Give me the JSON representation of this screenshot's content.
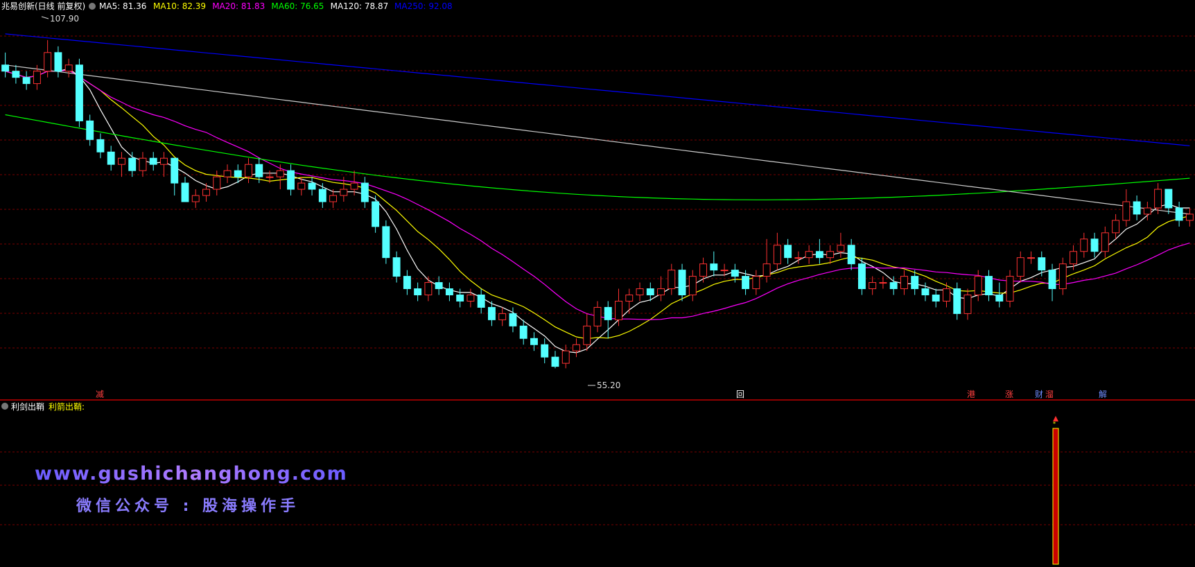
{
  "header": {
    "title": "兆易创新(日线 前复权)",
    "ma_items": [
      {
        "label": "MA5: 81.36",
        "color": "#ffffff"
      },
      {
        "label": "MA10: 82.39",
        "color": "#ffff00"
      },
      {
        "label": "MA20: 81.83",
        "color": "#ff00ff"
      },
      {
        "label": "MA60: 76.65",
        "color": "#00ff00"
      },
      {
        "label": "MA120: 78.87",
        "color": "#ffffff"
      },
      {
        "label": "MA250: 92.08",
        "color": "#0000ff"
      }
    ]
  },
  "indicator": {
    "name": "利剑出鞘",
    "value_label": "利箭出鞘:"
  },
  "watermark": {
    "url": "www.gushichanghong.com",
    "wechat": "微信公众号 : 股海操作手"
  },
  "colors": {
    "up": "#ff3232",
    "down": "#54ffff",
    "grid": "#7a0000",
    "ma5": "#ffffff",
    "ma10": "#ffff00",
    "ma20": "#ff00ff",
    "ma60": "#00ff00",
    "ma120": "#cccccc",
    "ma250": "#0000ff"
  },
  "chart_data": {
    "type": "candlestick",
    "y_range": [
      52,
      112
    ],
    "high_label": "107.90",
    "low_label": "55.20",
    "candles": [
      [
        104,
        103,
        106,
        102
      ],
      [
        103,
        102,
        104,
        101
      ],
      [
        102,
        101,
        103,
        100
      ],
      [
        101,
        103,
        104,
        100
      ],
      [
        103,
        106,
        108,
        102
      ],
      [
        106,
        103,
        107,
        102
      ],
      [
        103,
        104,
        105,
        102
      ],
      [
        104,
        95,
        105,
        94
      ],
      [
        95,
        92,
        96,
        91
      ],
      [
        92,
        90,
        93,
        89
      ],
      [
        90,
        88,
        91,
        87
      ],
      [
        88,
        89,
        90,
        86
      ],
      [
        89,
        87,
        90,
        86
      ],
      [
        87,
        89,
        90,
        86
      ],
      [
        89,
        88,
        90,
        87
      ],
      [
        88,
        89,
        90,
        86
      ],
      [
        89,
        85,
        89,
        83
      ],
      [
        85,
        82,
        86,
        82
      ],
      [
        82,
        83,
        84,
        81
      ],
      [
        83,
        84,
        85,
        82
      ],
      [
        84,
        86,
        87,
        83
      ],
      [
        86,
        87,
        88,
        85
      ],
      [
        87,
        86,
        88,
        85
      ],
      [
        86,
        88,
        89,
        85
      ],
      [
        88,
        86,
        89,
        85
      ],
      [
        86,
        86,
        87,
        85
      ],
      [
        86,
        87,
        88,
        84
      ],
      [
        87,
        84,
        88,
        83
      ],
      [
        84,
        85,
        86,
        83
      ],
      [
        85,
        84,
        86,
        83
      ],
      [
        84,
        82,
        85,
        81
      ],
      [
        82,
        83,
        84,
        81
      ],
      [
        83,
        84,
        86,
        82
      ],
      [
        84,
        85,
        87,
        83
      ],
      [
        85,
        82,
        86,
        81
      ],
      [
        82,
        78,
        83,
        77
      ],
      [
        78,
        73,
        79,
        72
      ],
      [
        73,
        70,
        74,
        69
      ],
      [
        70,
        68,
        71,
        67
      ],
      [
        68,
        67,
        69,
        66
      ],
      [
        67,
        69,
        70,
        66
      ],
      [
        69,
        68,
        70,
        67
      ],
      [
        68,
        67,
        69,
        66
      ],
      [
        67,
        66,
        68,
        65
      ],
      [
        66,
        67,
        68,
        65
      ],
      [
        67,
        65,
        68,
        64
      ],
      [
        65,
        63,
        66,
        62
      ],
      [
        63,
        64,
        65,
        62
      ],
      [
        64,
        62,
        65,
        61
      ],
      [
        62,
        60,
        63,
        59
      ],
      [
        60,
        59,
        61,
        58
      ],
      [
        59,
        57,
        60,
        56
      ],
      [
        57,
        55.5,
        58,
        55.2
      ],
      [
        56,
        58,
        59,
        55.2
      ],
      [
        58,
        59,
        60,
        57
      ],
      [
        59,
        62,
        64,
        58
      ],
      [
        62,
        65,
        66,
        61
      ],
      [
        65,
        63,
        66,
        60
      ],
      [
        63,
        66,
        68,
        62
      ],
      [
        66,
        67,
        68,
        64
      ],
      [
        67,
        68,
        69,
        66
      ],
      [
        68,
        67,
        69,
        66
      ],
      [
        67,
        68,
        70,
        66
      ],
      [
        68,
        71,
        72,
        67
      ],
      [
        71,
        67,
        72,
        66
      ],
      [
        67,
        70,
        71,
        66
      ],
      [
        70,
        72,
        73,
        69
      ],
      [
        72,
        71,
        74,
        70
      ],
      [
        71,
        71,
        72,
        70
      ],
      [
        71,
        70,
        72,
        69
      ],
      [
        70,
        68,
        71,
        67
      ],
      [
        68,
        70,
        71,
        67
      ],
      [
        70,
        72,
        76,
        69
      ],
      [
        72,
        75,
        77,
        71
      ],
      [
        75,
        73,
        76,
        72
      ],
      [
        73,
        73,
        74,
        72
      ],
      [
        73,
        74,
        75,
        72
      ],
      [
        74,
        73,
        76,
        72
      ],
      [
        73,
        74,
        75,
        72
      ],
      [
        74,
        75,
        77,
        73
      ],
      [
        75,
        72,
        76,
        71
      ],
      [
        72,
        68,
        73,
        67
      ],
      [
        68,
        69,
        70,
        67
      ],
      [
        69,
        69,
        70,
        68
      ],
      [
        69,
        68,
        70,
        67
      ],
      [
        68,
        70,
        71,
        67
      ],
      [
        70,
        68,
        71,
        67
      ],
      [
        68,
        67,
        69,
        66
      ],
      [
        67,
        66,
        68,
        65
      ],
      [
        66,
        68,
        69,
        65
      ],
      [
        68,
        64,
        69,
        63
      ],
      [
        64,
        67,
        68,
        63
      ],
      [
        67,
        70,
        71,
        66
      ],
      [
        70,
        67,
        71,
        66
      ],
      [
        67,
        66,
        69,
        65
      ],
      [
        66,
        70,
        71,
        65
      ],
      [
        70,
        73,
        74,
        69
      ],
      [
        73,
        73,
        74,
        72
      ],
      [
        73,
        71,
        74,
        70
      ],
      [
        71,
        68,
        72,
        66
      ],
      [
        68,
        72,
        73,
        67
      ],
      [
        72,
        74,
        75,
        71
      ],
      [
        74,
        76,
        77,
        73
      ],
      [
        76,
        74,
        77,
        73
      ],
      [
        74,
        77,
        78,
        73
      ],
      [
        77,
        79,
        80,
        76
      ],
      [
        79,
        82,
        84,
        78
      ],
      [
        82,
        80,
        83,
        79
      ],
      [
        80,
        81,
        82,
        79
      ],
      [
        81,
        84,
        85,
        80
      ],
      [
        84,
        81,
        84,
        80
      ],
      [
        81,
        79,
        82,
        78
      ],
      [
        79,
        80,
        81,
        78
      ]
    ],
    "signals": [
      {
        "label": "减",
        "color": "#ff4040"
      },
      {
        "label": "回",
        "color": "#ffffff"
      },
      {
        "label": "港",
        "color": "#ff4040"
      },
      {
        "label": "涨",
        "color": "#ff4040"
      },
      {
        "label": "财",
        "color": "#6f8cff"
      },
      {
        "label": "溜",
        "color": "#ff4040"
      },
      {
        "label": "解",
        "color": "#6f8cff"
      }
    ]
  }
}
